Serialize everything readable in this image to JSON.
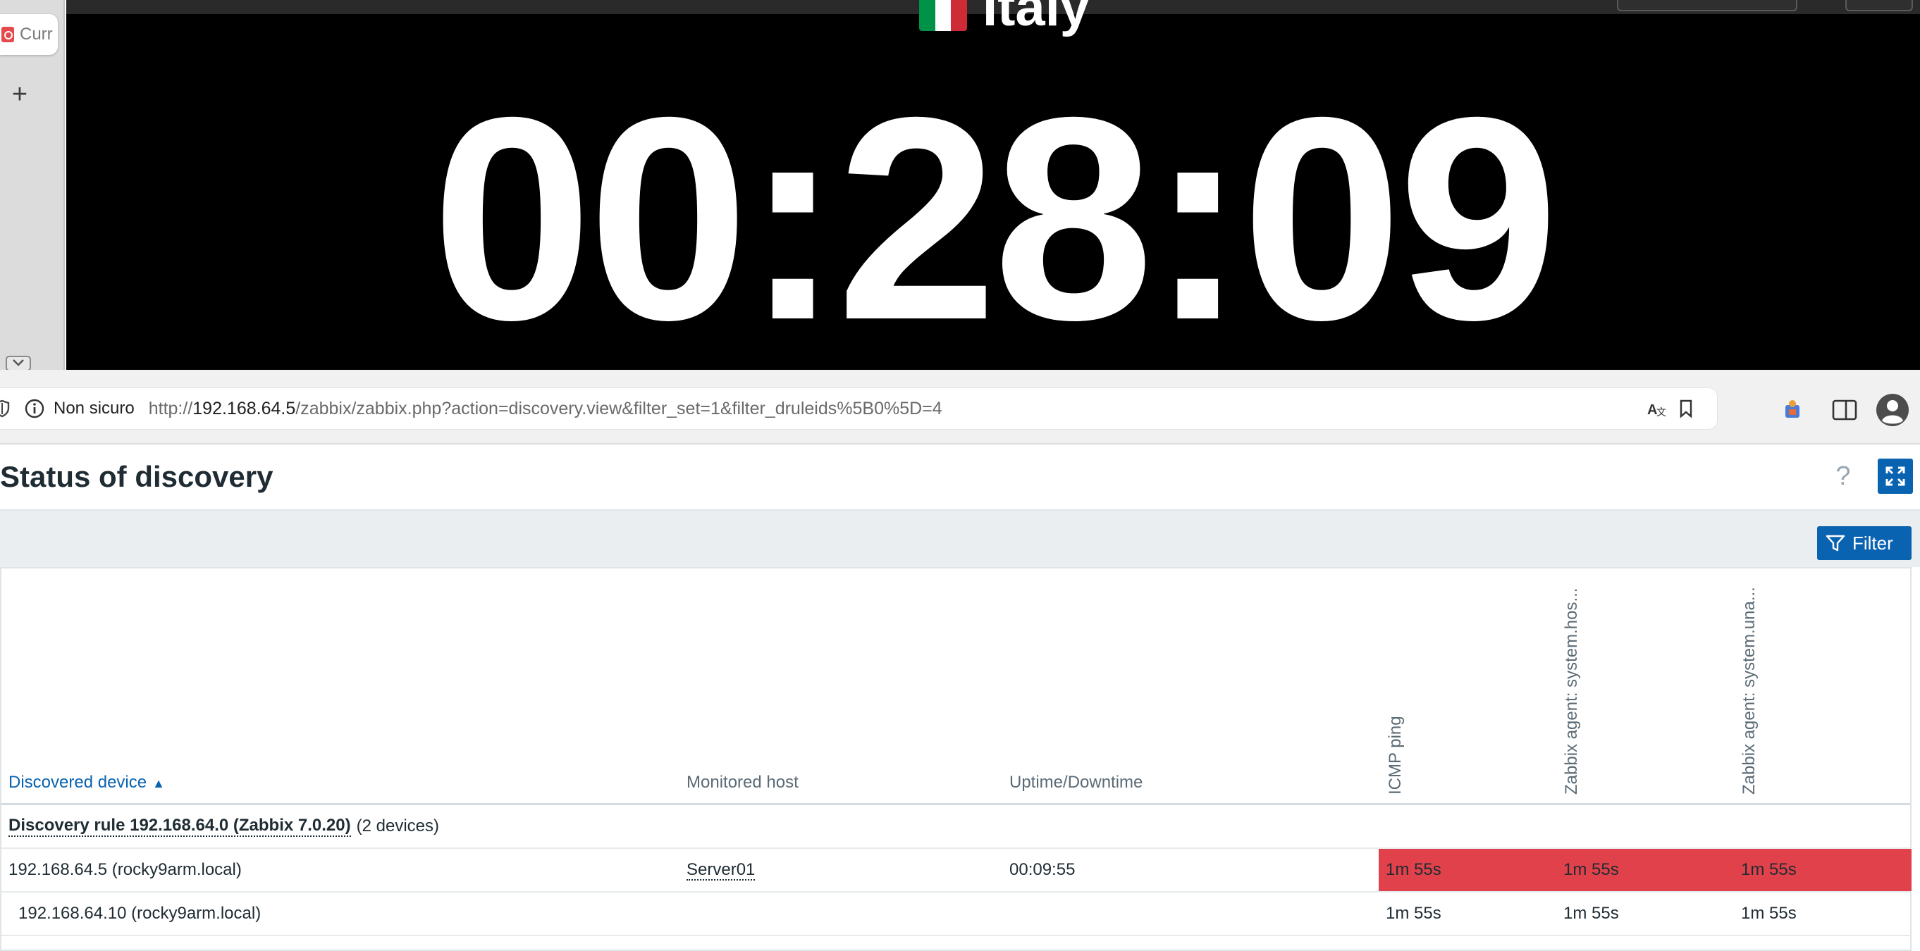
{
  "sidebar": {
    "tab_label": "Curr",
    "new_tab_symbol": "+"
  },
  "clock": {
    "country": "Italy",
    "time": "00:28:09",
    "flag_colors": [
      "#009246",
      "#ffffff",
      "#ce2b37"
    ]
  },
  "browser": {
    "security_label": "Non sicuro",
    "url_scheme": "http://",
    "url_host": "192.168.64.5",
    "url_rest": "/zabbix/zabbix.php?action=discovery.view&filter_set=1&filter_druleids%5B0%5D=4"
  },
  "page": {
    "title": "Status of discovery",
    "help_symbol": "?",
    "filter_label": "Filter"
  },
  "table": {
    "columns": {
      "device": "Discovered device",
      "sort_indicator": "▲",
      "host": "Monitored host",
      "uptime": "Uptime/Downtime",
      "icmp": "ICMP ping",
      "agent_host": "Zabbix agent: system.hos...",
      "agent_uname": "Zabbix agent: system.una..."
    },
    "rule": {
      "name": "Discovery rule 192.168.64.0 (Zabbix 7.0.20)",
      "count": "(2 devices)"
    },
    "rows": [
      {
        "device": "192.168.64.5 (rocky9arm.local)",
        "host": "Server01",
        "uptime": "00:09:55",
        "services": [
          "1m 55s",
          "1m 55s",
          "1m 55s"
        ],
        "status": "down"
      },
      {
        "device": "192.168.64.10 (rocky9arm.local)",
        "host": "",
        "uptime": "",
        "services": [
          "1m 55s",
          "1m 55s",
          "1m 55s"
        ],
        "status": "up"
      }
    ],
    "down_color": "#e0414a"
  },
  "colors": {
    "brand_blue": "#0a63b0"
  }
}
